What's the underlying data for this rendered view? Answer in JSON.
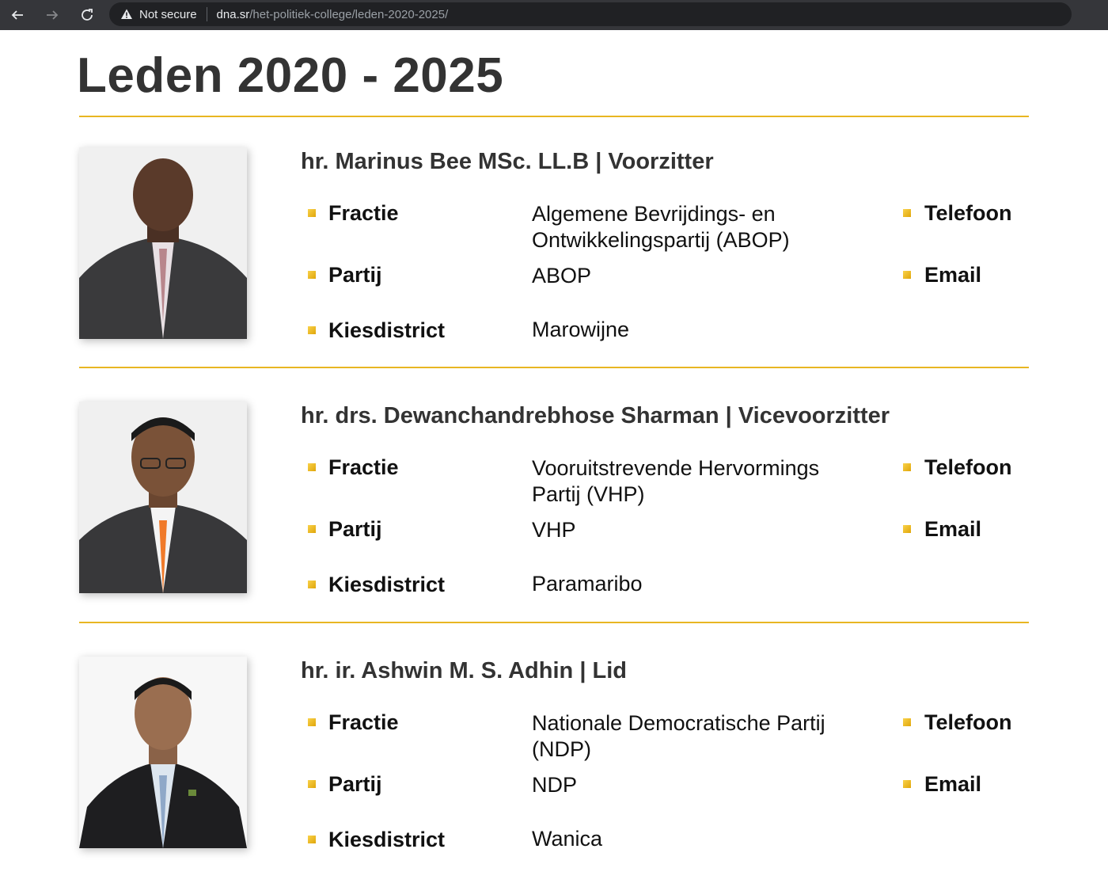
{
  "browser": {
    "security_label": "Not secure",
    "url_host": "dna.sr",
    "url_path": "/het-politiek-college/leden-2020-2025/"
  },
  "page": {
    "title": "Leden 2020 - 2025"
  },
  "labels": {
    "fractie": "Fractie",
    "partij": "Partij",
    "kiesdistrict": "Kiesdistrict",
    "telefoon": "Telefoon",
    "email": "Email"
  },
  "members": [
    {
      "name": "hr. Marinus Bee MSc. LL.B  |  Voorzitter",
      "fractie_line1": "Algemene Bevrijdings- en",
      "fractie_line2": "Ontwikkelingspartij  (ABOP)",
      "partij": "ABOP",
      "kiesdistrict": "Marowijne"
    },
    {
      "name": "hr. drs. Dewanchandrebhose Sharman  |  Vicevoorzitter",
      "fractie_line1": "Vooruitstrevende Hervormings",
      "fractie_line2": "Partij  (VHP)",
      "partij": "VHP",
      "kiesdistrict": "Paramaribo"
    },
    {
      "name": "hr. ir. Ashwin M. S. Adhin  |  Lid",
      "fractie_line1": "Nationale Democratische Partij",
      "fractie_line2": "(NDP)",
      "partij": "NDP",
      "kiesdistrict": "Wanica"
    }
  ]
}
